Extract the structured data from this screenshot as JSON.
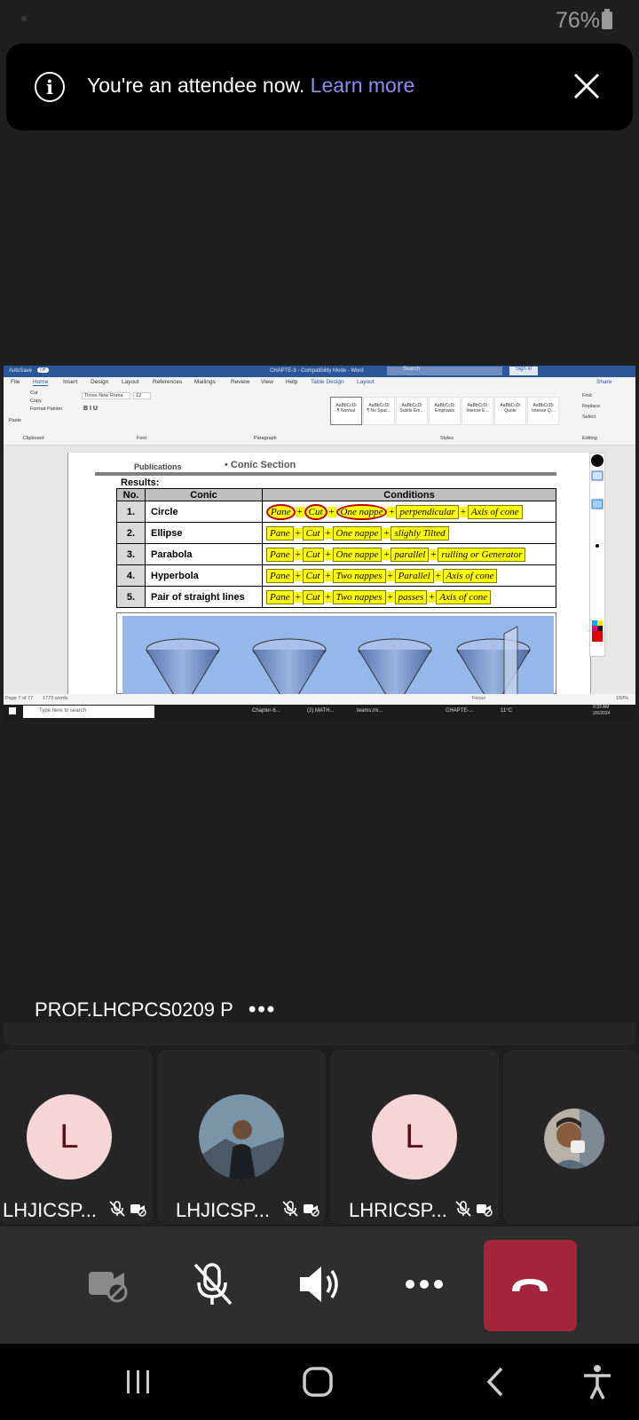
{
  "status_bar": {
    "battery": "76%"
  },
  "banner": {
    "text": "You're an attendee now.",
    "link": "Learn more"
  },
  "shared_screen": {
    "title_bar": {
      "autosave": "AutoSave",
      "autosave_state": "Off",
      "doc_title": "CHAPTE-3 - Compatibility Mode - Word",
      "search": "Search",
      "sign_in": "Sign in"
    },
    "tabs": [
      "File",
      "Home",
      "Insert",
      "Design",
      "Layout",
      "References",
      "Mailings",
      "Review",
      "View",
      "Help",
      "Table Design",
      "Layout"
    ],
    "share": "Share",
    "ribbon": {
      "paste": "Paste",
      "cut": "Cut",
      "copy": "Copy",
      "format_painter": "Format Painter",
      "font": "Times New Roma",
      "size": "12",
      "groups": [
        "Clipboard",
        "Font",
        "Paragraph",
        "Styles",
        "Editing"
      ],
      "styles": [
        "¶ Normal",
        "¶ No Spac...",
        "Subtle Em...",
        "Emphasis",
        "Intense E...",
        "Quote",
        "Intense Q..."
      ],
      "style_sample": "AaBbCcDi",
      "find": "Find",
      "replace": "Replace",
      "select": "Select"
    },
    "document": {
      "publications": "Publications",
      "section": "Conic Section",
      "results": "Results:",
      "table": {
        "headers": [
          "No.",
          "Conic",
          "Conditions"
        ],
        "rows": [
          {
            "no": "1.",
            "conic": "Circle",
            "conditions": [
              "Pane",
              "Cut",
              "One nappe",
              "perpendicular",
              "Axis of cone"
            ]
          },
          {
            "no": "2.",
            "conic": "Ellipse",
            "conditions": [
              "Pane",
              "Cut",
              "One nappe",
              "slighly Tilted"
            ]
          },
          {
            "no": "3.",
            "conic": "Parabola",
            "conditions": [
              "Pane",
              "Cut",
              "One nappe",
              "parallel",
              "rulling or Generator"
            ]
          },
          {
            "no": "4.",
            "conic": "Hyperbola",
            "conditions": [
              "Pane",
              "Cut",
              "Two nappes",
              "Parallel",
              "Axis of cone"
            ]
          },
          {
            "no": "5.",
            "conic": "Pair of straight lines",
            "conditions": [
              "Pane",
              "Cut",
              "Two nappes",
              "passes",
              "Axis of cone"
            ]
          }
        ]
      }
    },
    "statusbar": {
      "page": "Page 7 of 77",
      "words": "1773 words",
      "focus": "Focus",
      "zoom": "150%"
    },
    "taskbar": {
      "search": "Type here to search",
      "apps": [
        "Chapter-6...",
        "(2) MATH...",
        "teams.mi...",
        "CHAPTE-..."
      ],
      "temp": "11°C",
      "time": "9:33 AM",
      "date": "2/6/2024"
    }
  },
  "presenter": {
    "name": "PROF.LHCPCS0209 P"
  },
  "participants": [
    {
      "name": "LHJICSP...",
      "initial": "L",
      "avatar": "letter"
    },
    {
      "name": "LHJICSP...",
      "initial": "",
      "avatar": "photo"
    },
    {
      "name": "LHRICSP...",
      "initial": "L",
      "avatar": "letter"
    },
    {
      "name": "",
      "initial": "",
      "avatar": "photo"
    }
  ],
  "colors": {
    "leave_red": "#a4263c",
    "link_purple": "#8c8ff0",
    "avatar_pink": "#f5d5d7",
    "highlight_yellow": "#ffff00"
  }
}
